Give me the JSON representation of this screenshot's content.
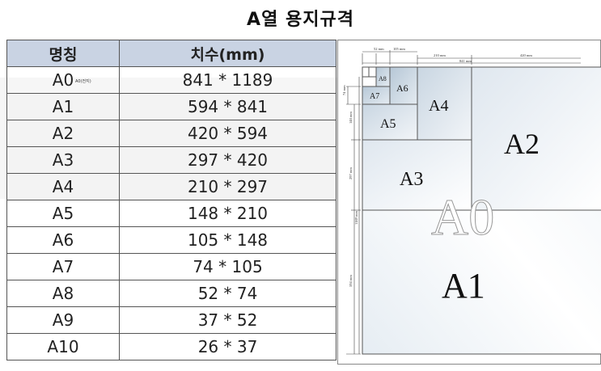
{
  "title": "A열 용지규격",
  "table": {
    "headers": [
      "명칭",
      "치수(mm)"
    ],
    "rows": [
      {
        "name": "A0",
        "note": "A0(전지)",
        "size": "841 * 1189"
      },
      {
        "name": "A1",
        "size": "594 * 841"
      },
      {
        "name": "A2",
        "size": "420 * 594"
      },
      {
        "name": "A3",
        "size": "297 * 420"
      },
      {
        "name": "A4",
        "size": "210 * 297"
      },
      {
        "name": "A5",
        "size": "148 * 210"
      },
      {
        "name": "A6",
        "size": "105 * 148"
      },
      {
        "name": "A7",
        "size": "74 * 105"
      },
      {
        "name": "A8",
        "size": "52 * 74"
      },
      {
        "name": "A9",
        "size": "37 * 52"
      },
      {
        "name": "A10",
        "size": "26 * 37"
      }
    ]
  },
  "diagram": {
    "labels": {
      "a0": "A0",
      "a1": "A1",
      "a2": "A2",
      "a3": "A3",
      "a4": "A4",
      "a5": "A5",
      "a6": "A6",
      "a7": "A7",
      "a8": "A8"
    },
    "dims": {
      "d52": "52 mm",
      "d105": "105 mm",
      "d210": "210 mm",
      "d420": "420 mm",
      "d841": "841 mm",
      "d74": "74 mm",
      "d148": "148 mm",
      "d297": "297 mm",
      "d1189": "1189 mm",
      "d594": "594 mm"
    }
  },
  "colors": {
    "header_bg": "#c9d3e3",
    "border": "#555555",
    "paper_shade": "#dfe7ef"
  }
}
